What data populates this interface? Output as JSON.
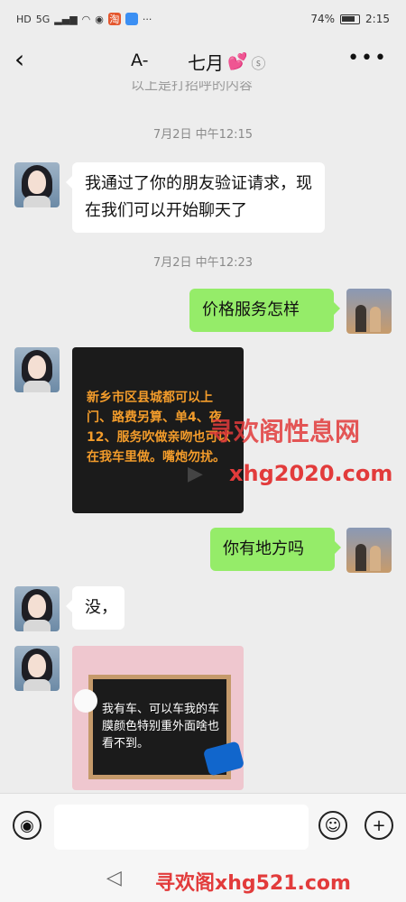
{
  "status_bar": {
    "network_left": "HD",
    "network_small": "5G",
    "tag_red_char": "淘",
    "battery_percent": "74%",
    "time": "2:15"
  },
  "header": {
    "back_icon": "chevron-left-icon",
    "font_toggle": "A-",
    "title": "七月",
    "title_emoji": "💕",
    "ear_icon": "hearing-icon",
    "more_icon": "more-icon"
  },
  "chat": {
    "clipped_text": "以上是打招呼的内容",
    "timestamps": [
      "7月2日 中午12:15",
      "7月2日 中午12:23"
    ],
    "messages": [
      {
        "from": "other",
        "text": "我通过了你的朋友验证请求，现在我们可以开始聊天了"
      },
      {
        "from": "me",
        "text": "价格服务怎样"
      },
      {
        "from": "other",
        "type": "image",
        "caption": "新乡市区县城都可以上门、路费另算、单4、夜12、服务吹做亲吻也可以在我车里做。嘴炮勿扰。"
      },
      {
        "from": "me",
        "text": "你有地方吗"
      },
      {
        "from": "other",
        "text": "没，"
      },
      {
        "from": "other",
        "type": "image",
        "caption": "我有车、可以车我的车膜颜色特别重外面啥也看不到。"
      }
    ]
  },
  "watermarks": {
    "wm1": "寻欢阁性息网",
    "wm2": "xhg2020.com",
    "wm3": "寻欢阁xhg521.com"
  },
  "input_bar": {
    "voice_icon": "voice-icon",
    "emoji_icon": "emoji-icon",
    "plus_icon": "plus-icon",
    "placeholder": ""
  },
  "nav_bar": {
    "back_icon": "nav-back-icon"
  },
  "colors": {
    "bubble_me": "#95ec69",
    "bubble_other": "#ffffff",
    "background": "#ededed",
    "watermark": "#e23b3b"
  }
}
